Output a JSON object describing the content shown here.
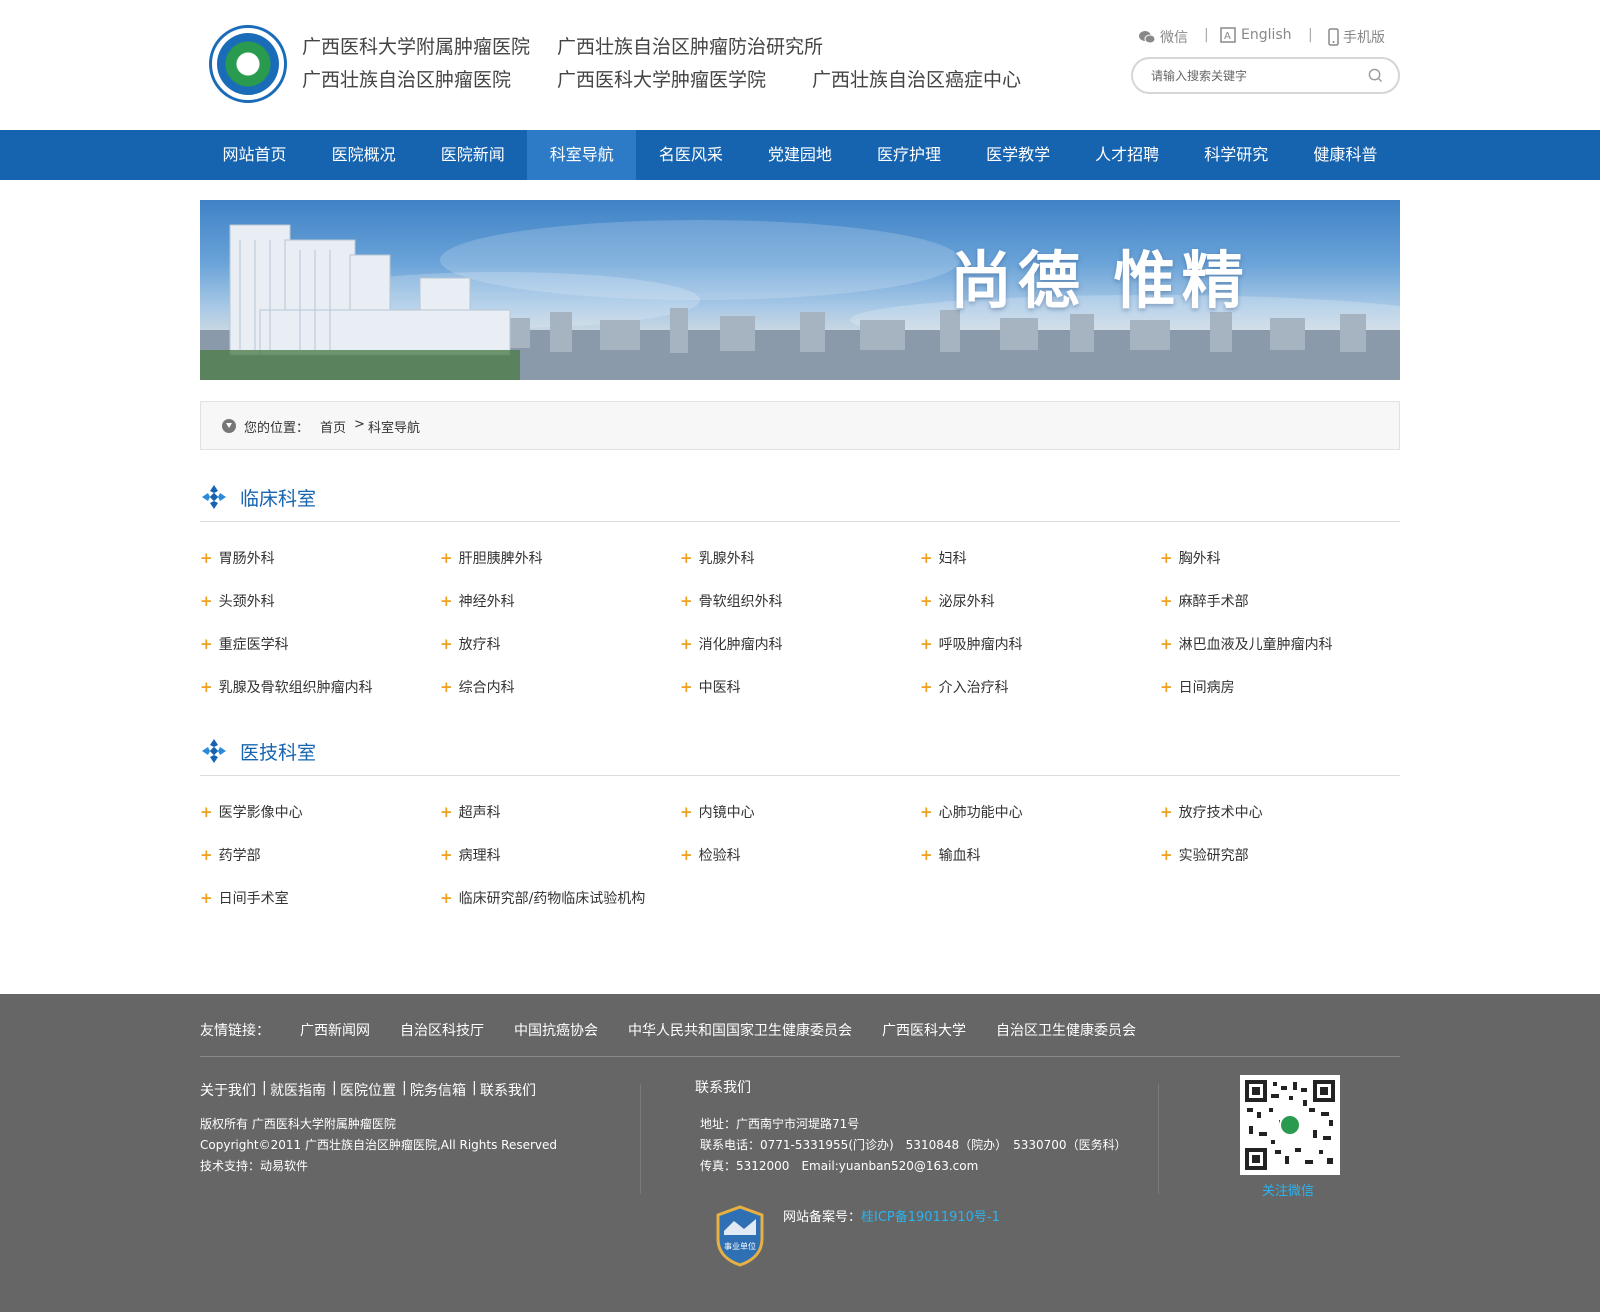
{
  "header": {
    "titles_row1": [
      "广西医科大学附属肿瘤医院",
      "广西壮族自治区肿瘤防治研究所"
    ],
    "titles_row2": [
      "广西壮族自治区肿瘤医院",
      "广西医科大学肿瘤医学院",
      "广西壮族自治区癌症中心"
    ],
    "util": {
      "wechat": "微信",
      "english": "English",
      "mobile": "手机版",
      "sep": "|"
    },
    "search": {
      "placeholder": "请输入搜索关键字"
    }
  },
  "nav": {
    "items": [
      "网站首页",
      "医院概况",
      "医院新闻",
      "科室导航",
      "名医风采",
      "党建园地",
      "医疗护理",
      "医学教学",
      "人才招聘",
      "科学研究",
      "健康科普"
    ],
    "active_index": 3
  },
  "banner": {
    "slogan": "尚德 惟精"
  },
  "breadcrumb": {
    "label": "您的位置：",
    "home": "首页",
    "arrow": ">",
    "current": "科室导航"
  },
  "clinical": {
    "title": "临床科室",
    "items": [
      "胃肠外科",
      "肝胆胰脾外科",
      "乳腺外科",
      "妇科",
      "胸外科",
      "头颈外科",
      "神经外科",
      "骨软组织外科",
      "泌尿外科",
      "麻醉手术部",
      "重症医学科",
      "放疗科",
      "消化肿瘤内科",
      "呼吸肿瘤内科",
      "淋巴血液及儿童肿瘤内科",
      "乳腺及骨软组织肿瘤内科",
      "综合内科",
      "中医科",
      "介入治疗科",
      "日间病房"
    ]
  },
  "medtech": {
    "title": "医技科室",
    "items": [
      "医学影像中心",
      "超声科",
      "内镜中心",
      "心肺功能中心",
      "放疗技术中心",
      "药学部",
      "病理科",
      "检验科",
      "输血科",
      "实验研究部",
      "日间手术室",
      "临床研究部/药物临床试验机构"
    ]
  },
  "footer": {
    "links_label": "友情链接：",
    "links": [
      "广西新闻网",
      "自治区科技厅",
      "中国抗癌协会",
      "中华人民共和国国家卫生健康委员会",
      "广西医科大学",
      "自治区卫生健康委员会"
    ],
    "menu": [
      "关于我们",
      "|",
      "就医指南",
      "|",
      "医院位置",
      "|",
      "院务信箱",
      "|",
      "联系我们"
    ],
    "copyright": [
      "版权所有 广西医科大学附属肿瘤医院",
      "Copyright©2011 广西壮族自治区肿瘤医院,All Rights Reserved",
      "技术支持：动易软件"
    ],
    "contact_title": "联系我们",
    "contact": [
      "地址：广西南宁市河堤路71号",
      "联系电话：0771-5331955(门诊办)　5310848（院办）　5330700（医务科）",
      "传真：5312000　Email:yuanban520@163.com"
    ],
    "qr_label": "关注微信",
    "badge_text": "事业单位",
    "icp_label": "网站备案号：",
    "icp_value": "桂ICP备19011910号-1"
  },
  "colors": {
    "primary": "#1664b0",
    "nav_active": "#2d7bc6",
    "accent_plus": "#f0a020",
    "footer_bg": "#666666",
    "link_blue": "#2ab4ef"
  },
  "icons": [
    "wechat-icon",
    "english-icon",
    "mobile-icon",
    "search-icon",
    "location-icon",
    "section-icon",
    "plus-icon",
    "qr-code",
    "badge-icon"
  ]
}
